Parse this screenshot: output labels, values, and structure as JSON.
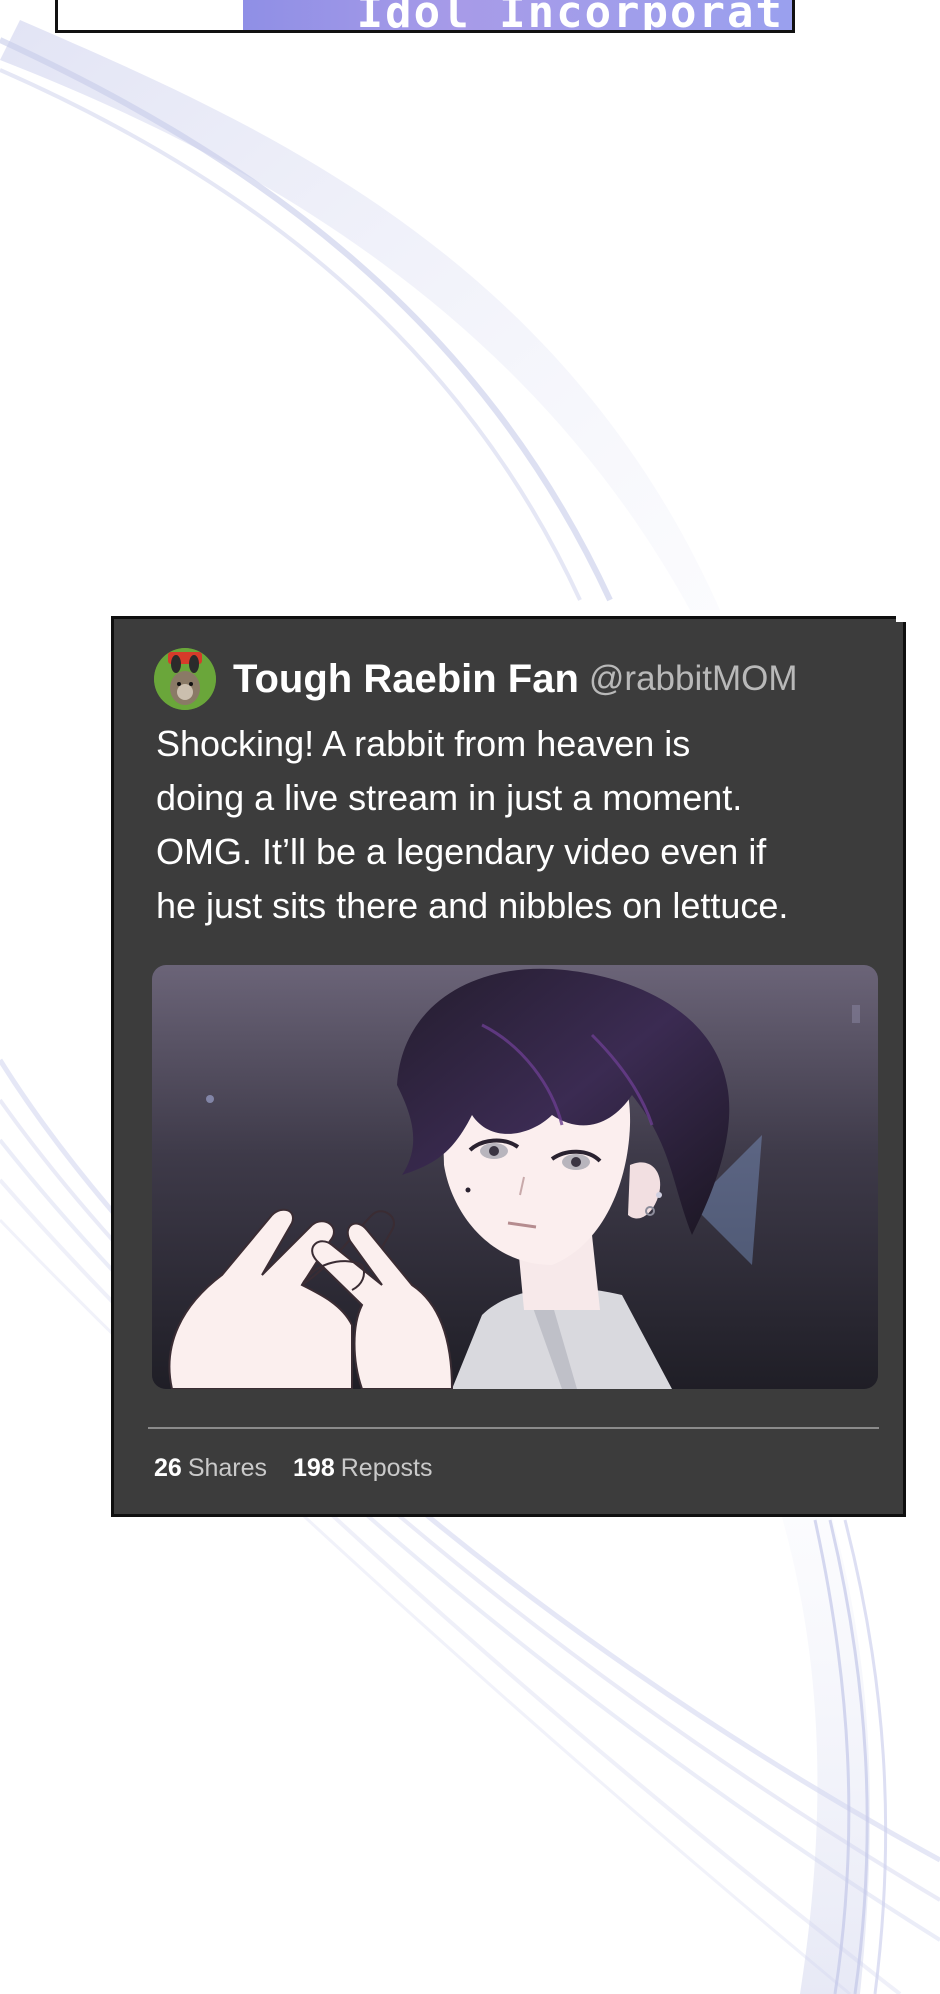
{
  "banner": {
    "text": "Idol Incorporat"
  },
  "post": {
    "user_name": "Tough Raebin Fan",
    "user_handle": "@rabbitMOM",
    "text_lines": [
      "Shocking! A rabbit from heaven is",
      "doing a live stream in just a moment.",
      "OMG. It’ll be a legendary video even if",
      "he just sits there and nibbles on lettuce."
    ],
    "image_icon": "dark-haired-man-heart-hands",
    "stats": {
      "shares_count": "26",
      "shares_label": "Shares",
      "reposts_count": "198",
      "reposts_label": "Reposts"
    }
  },
  "colors": {
    "card_bg": "#3c3c3c",
    "card_border": "#0f0f0f",
    "text_primary": "#ffffff",
    "text_secondary": "#b9b9b9",
    "banner_accent": "#9a98ea",
    "bg_ribbon": "#c9cdea"
  }
}
